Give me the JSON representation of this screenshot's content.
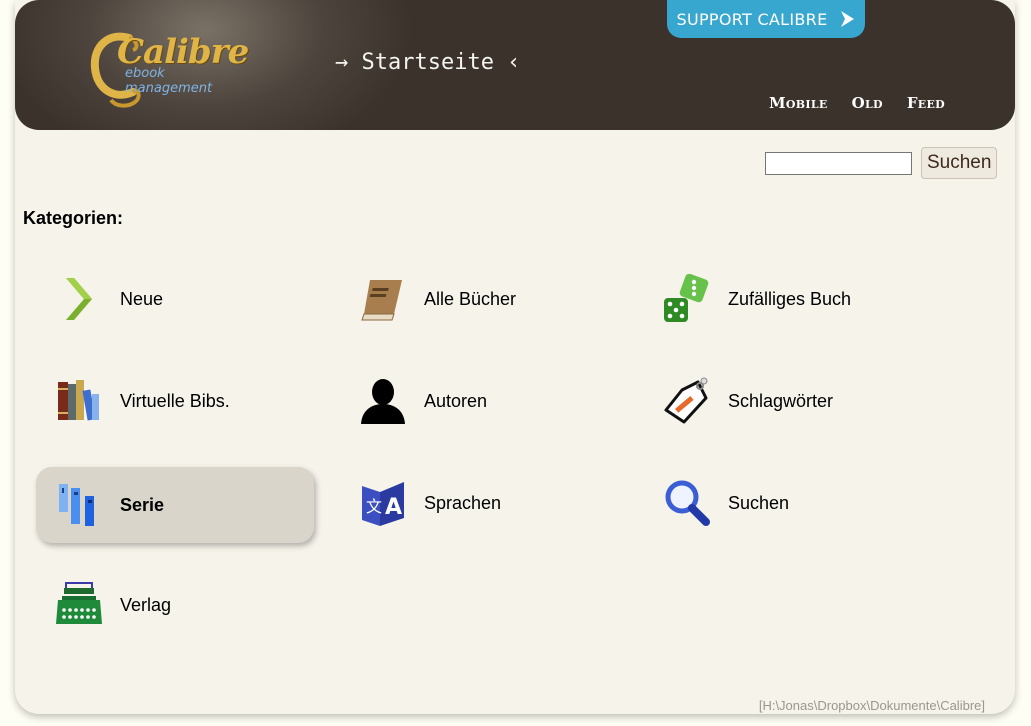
{
  "header": {
    "logo_text": "Calibre",
    "logo_sub": "ebook management",
    "breadcrumb": "→ Startseite ‹",
    "support_label": "SUPPORT CALIBRE",
    "nav": [
      "Mobile",
      "Old",
      "Feed"
    ]
  },
  "search": {
    "placeholder": "",
    "value": "",
    "button_label": "Suchen"
  },
  "categories_heading": "Kategorien:",
  "categories": [
    {
      "label": "Neue",
      "icon": "chevron-right-icon",
      "active": false
    },
    {
      "label": "Alle Bücher",
      "icon": "book-icon",
      "active": false
    },
    {
      "label": "Zufälliges Buch",
      "icon": "dice-icon",
      "active": false
    },
    {
      "label": "Virtuelle Bibs.",
      "icon": "bookshelf-icon",
      "active": false
    },
    {
      "label": "Autoren",
      "icon": "user-silhouette-icon",
      "active": false
    },
    {
      "label": "Schlagwörter",
      "icon": "tag-icon",
      "active": false
    },
    {
      "label": "Serie",
      "icon": "series-icon",
      "active": true
    },
    {
      "label": "Sprachen",
      "icon": "language-icon",
      "active": false
    },
    {
      "label": "Suchen",
      "icon": "magnifier-icon",
      "active": false
    },
    {
      "label": "Verlag",
      "icon": "typewriter-icon",
      "active": false
    }
  ],
  "footer_path": "[H:\\Jonas\\Dropbox\\Dokumente\\Calibre]",
  "colors": {
    "header_bg": "#3a322b",
    "support_bg": "#38a7cf",
    "page_bg": "#f5f3ea",
    "active_bg": "#d9d5cb"
  }
}
